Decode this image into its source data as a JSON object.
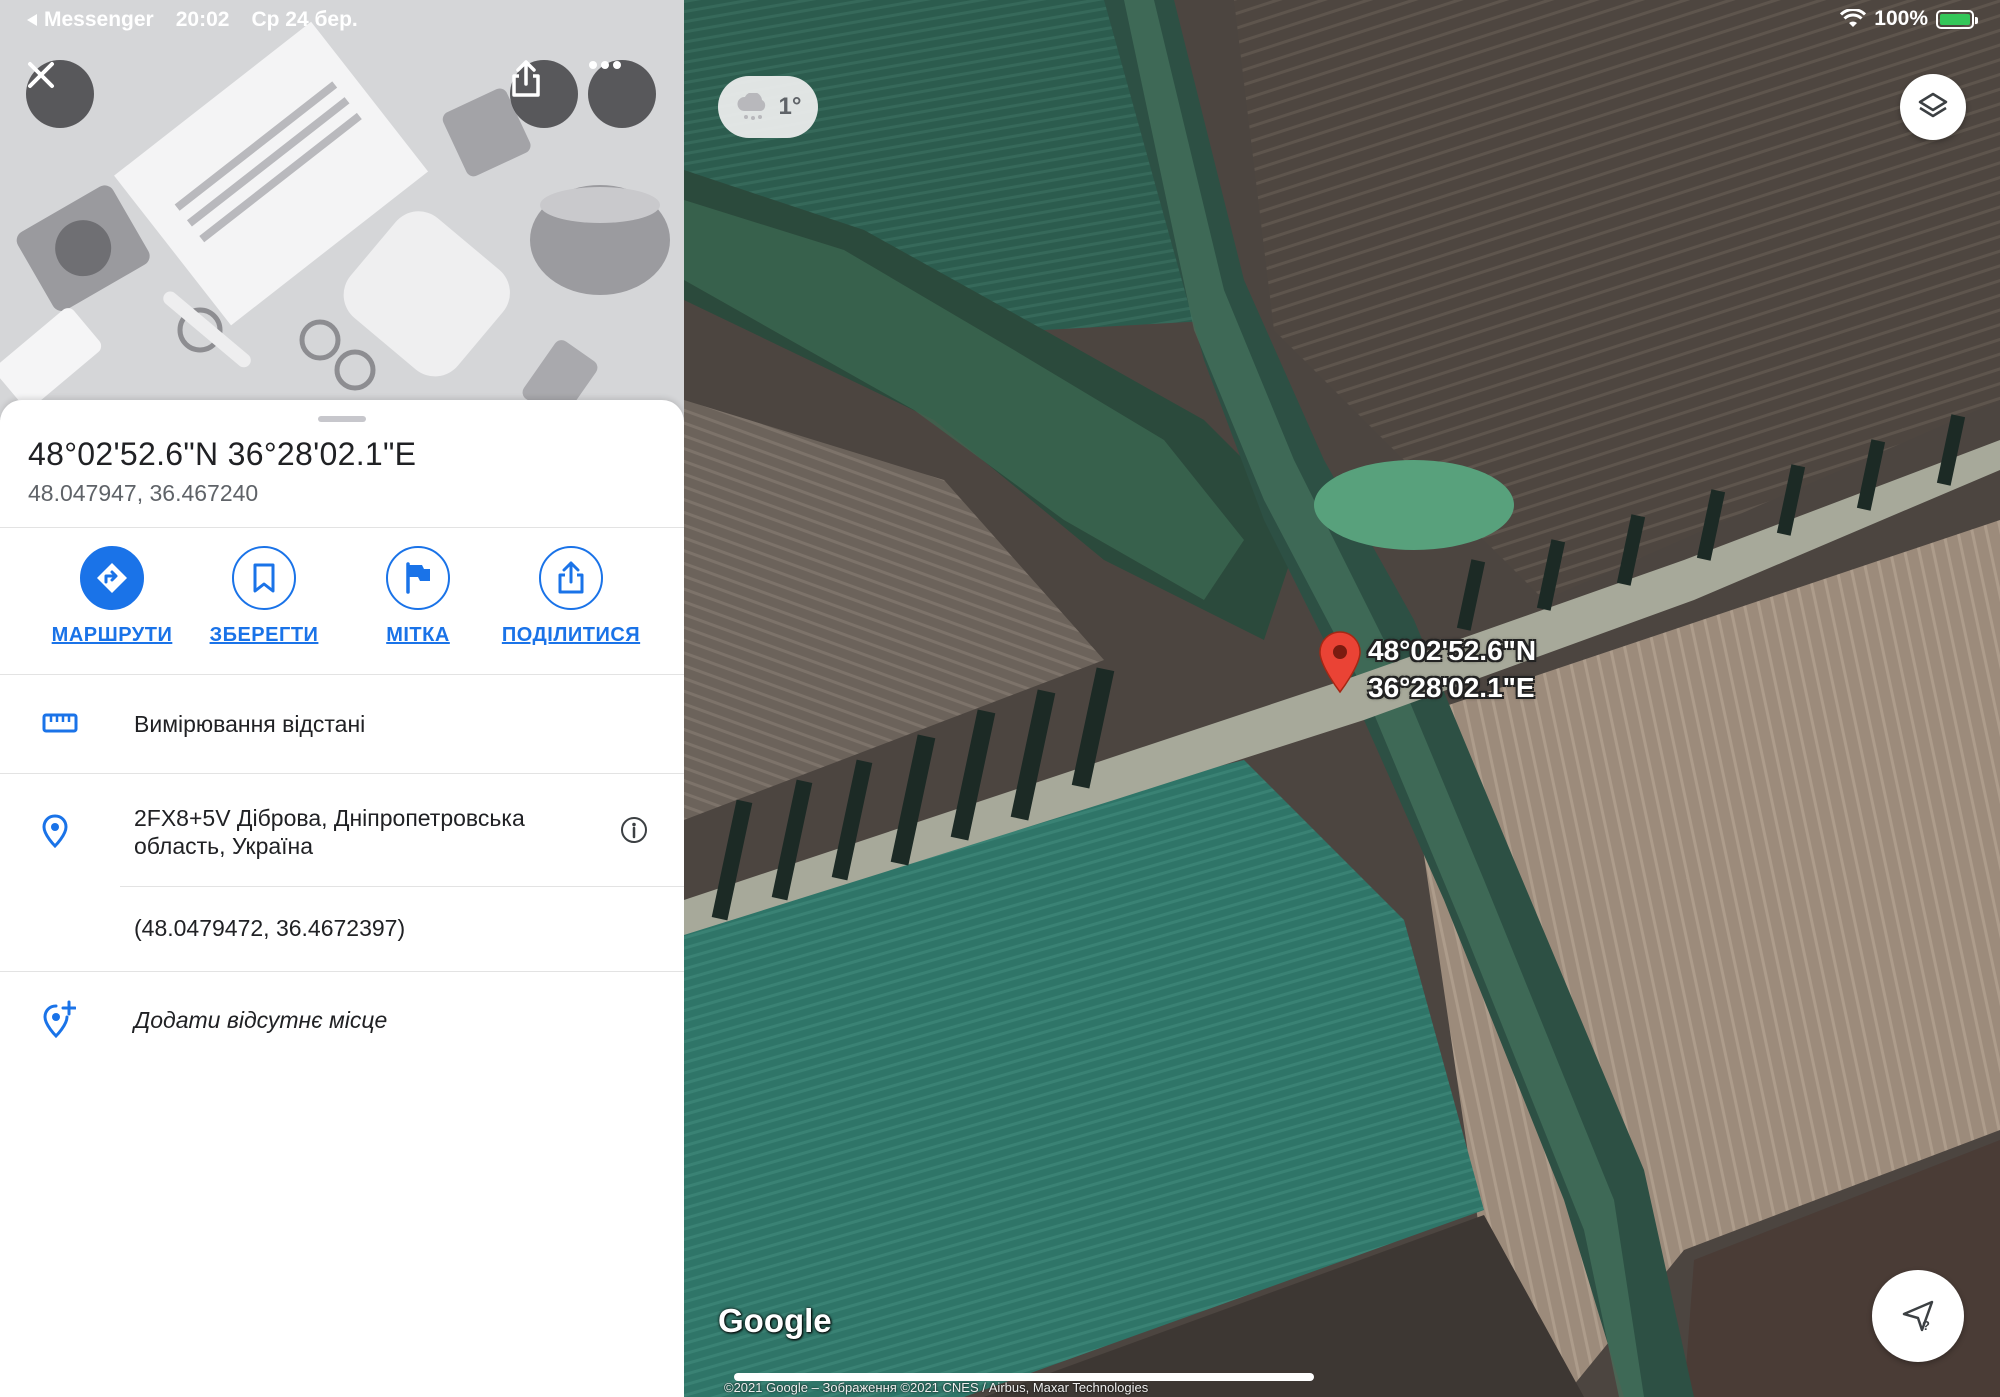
{
  "status_bar": {
    "back_app": "Messenger",
    "time": "20:02",
    "date": "Ср 24 бер.",
    "battery": "100%"
  },
  "place": {
    "title": "48°02'52.6\"N 36°28'02.1\"E",
    "decimal_coords": "48.047947, 36.467240"
  },
  "actions": [
    {
      "label": "МАРШРУТИ",
      "icon": "directions-icon"
    },
    {
      "label": "ЗБЕРЕГТИ",
      "icon": "bookmark-icon"
    },
    {
      "label": "МІТКА",
      "icon": "flag-icon"
    },
    {
      "label": "ПОДІЛИТИСЯ",
      "icon": "share-icon"
    }
  ],
  "rows": {
    "measure": "Вимірювання відстані",
    "address_line1": "2FX8+5V Діброва, Дніпропетровська",
    "address_line2": "область, Україна",
    "precise_coords": "(48.0479472, 36.4672397)",
    "add_missing": "Додати відсутнє місце"
  },
  "map": {
    "weather_temp": "1°",
    "pin_label_line1": "48°02'52.6\"N",
    "pin_label_line2": "36°28'02.1\"E",
    "logo": "Google",
    "copyright": "©2021 Google – Зображення ©2021 CNES / Airbus, Maxar Technologies"
  },
  "colors": {
    "accent": "#1a73e8",
    "pin": "#ea4335"
  }
}
